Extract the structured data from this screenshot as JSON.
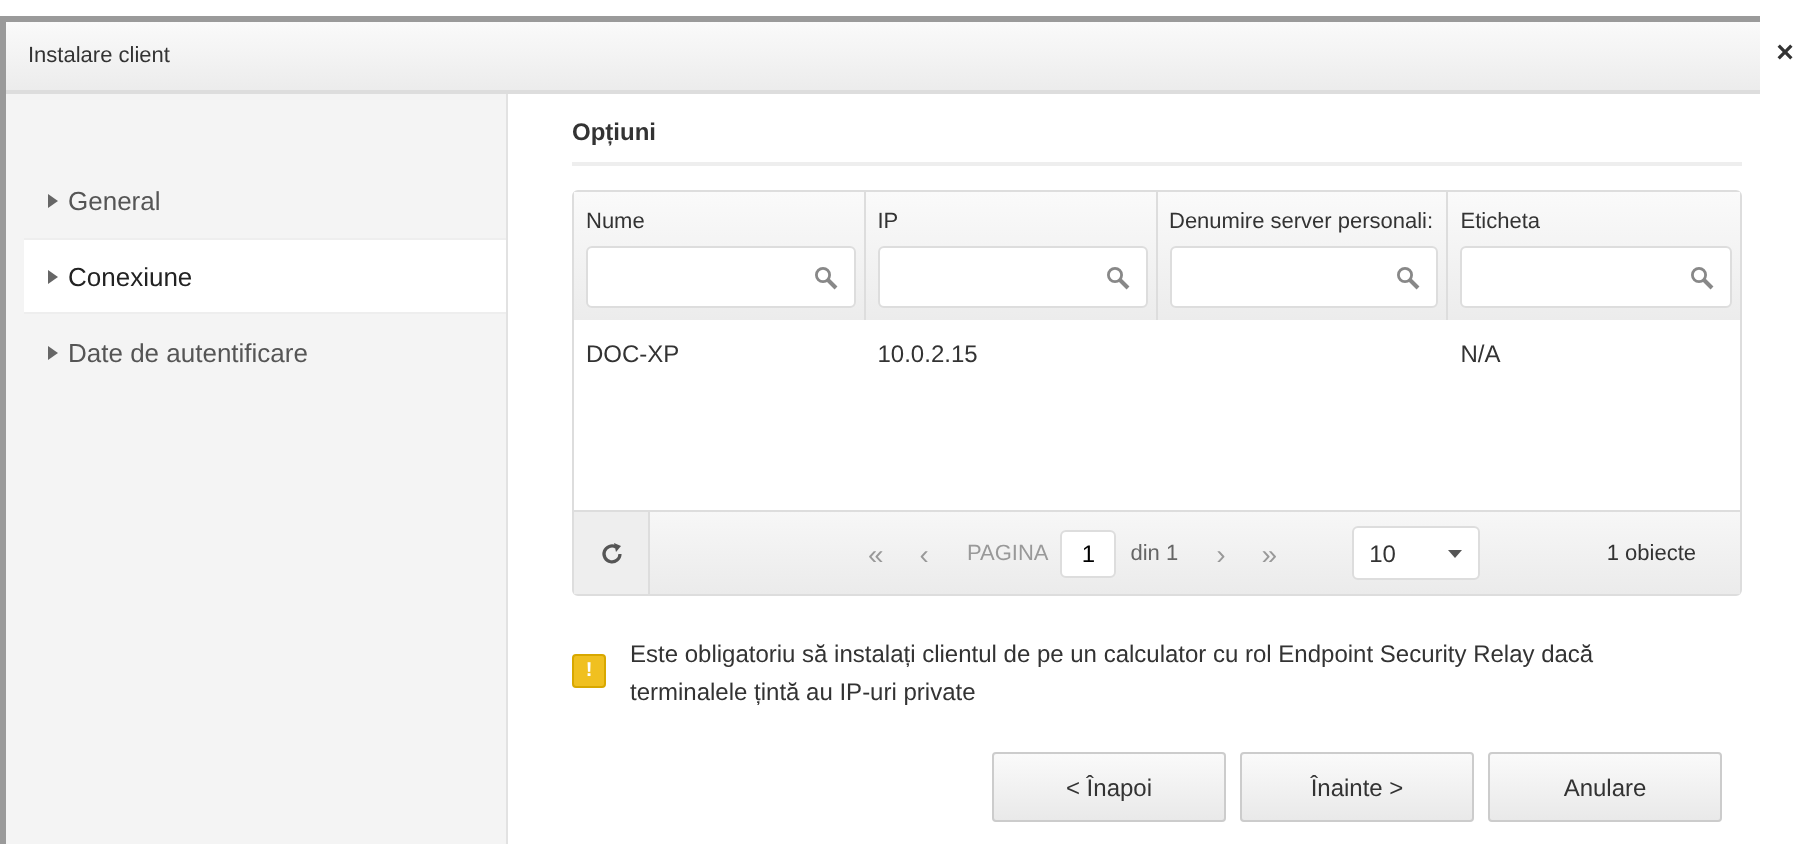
{
  "window": {
    "title": "Instalare client",
    "close": "×"
  },
  "sidebar": {
    "items": [
      {
        "label": "General",
        "selected": false
      },
      {
        "label": "Conexiune",
        "selected": true
      },
      {
        "label": "Date de autentificare",
        "selected": false
      }
    ]
  },
  "section_title": "Opțiuni",
  "table": {
    "columns": [
      "Nume",
      "IP",
      "Denumire server personali:",
      "Eticheta"
    ],
    "rows": [
      [
        "DOC-XP",
        "10.0.2.15",
        "",
        "N/A"
      ]
    ],
    "pager": {
      "first": "«",
      "prev": "‹",
      "page_label": "PAGINA",
      "page": "1",
      "of": "din 1",
      "next": "›",
      "last": "»",
      "nav_disabled": true,
      "page_size": "10",
      "count": "1 obiecte"
    }
  },
  "warning": {
    "icon": "!",
    "text": "Este obligatoriu să instalați clientul de pe un calculator cu rol Endpoint Security Relay dacă terminalele țintă au IP-uri private"
  },
  "buttons": [
    "< Înapoi",
    "Înainte >",
    "Anulare"
  ]
}
